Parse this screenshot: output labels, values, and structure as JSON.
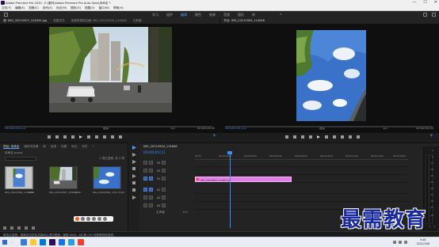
{
  "window": {
    "title": "Adobe Premiere Pro 2020 - E:\\素材\\Adobe Premiere Pro Auto-Save\\未命名 *",
    "controls": [
      "—",
      "☐",
      "✕"
    ]
  },
  "menu": [
    "文件(F)",
    "编辑(E)",
    "剪辑(C)",
    "序列(S)",
    "标记(M)",
    "图形(G)",
    "视图(V)",
    "窗口(W)",
    "帮助(H)"
  ],
  "workspace": {
    "tabs": [
      "学习",
      "组件",
      "编辑",
      "颜色",
      "效果",
      "音频",
      "图形",
      "库"
    ],
    "active": "编辑",
    "more": "»"
  },
  "source_monitor": {
    "tabs": [
      "源: IMG_20210907_154045.jpg",
      "效果控件",
      "音频剪辑混合器: IMG_20210904_114846",
      "元数据"
    ],
    "timecode": "00;00;01;11",
    "fit": "适合",
    "ratio": "1/2",
    "duration": "00;00;05;00"
  },
  "program_monitor": {
    "tabs": [
      "节目: IMG_20210904_114846"
    ],
    "timecode": "00;00;01;11",
    "fit": "适合",
    "ratio": "1/2",
    "duration": "00;00;05;00"
  },
  "project": {
    "tabs": [
      "项目: 未命名",
      "媒体浏览器",
      "库",
      "信息",
      "效果",
      "标记",
      "历史"
    ],
    "more": "»",
    "file": "未命名.prproj",
    "count": "1 项已选择, 共 3 项",
    "items": [
      {
        "name": "IMG_20210904_114846...",
        "duration": "5;00"
      },
      {
        "name": "IMG_20210907_154045...",
        "duration": "5;00"
      },
      {
        "name": "IMG_20210904_1157...",
        "duration": "5;00"
      }
    ]
  },
  "timeline": {
    "tab": "IMG_20210904_114846",
    "timecode": "00;00;01;11",
    "ruler": [
      "00;00",
      "00;00;02;00",
      "00;00;04;00",
      "00;00;06;00",
      "00;00;08;00",
      "00;00;10;00",
      "00;00;12;00",
      "00;00;14;00",
      "00;00;16;00"
    ],
    "video_tracks": [
      "V3",
      "V2",
      "V1"
    ],
    "audio_tracks": [
      "A1",
      "A2",
      "A3"
    ],
    "master_label": "主声道",
    "master_value": "0.0",
    "clip_name": "IMG_20210904_114846.jpg",
    "meter_labels": [
      "0",
      "-6",
      "-12",
      "-18",
      "-24",
      "-30",
      "-36",
      "-42",
      "-48",
      "-54",
      "dB"
    ],
    "meter_solo": [
      "S",
      "S"
    ]
  },
  "hint": "单击以选择，或单击空白处并拖动以进行框选。使用 Shift、Alt 和 Ctrl 可获得其他选项。",
  "taskbar": {
    "search": "○",
    "time": "9:48",
    "date": "2021/10/8",
    "icons": [
      "#3a7bd5",
      "#ffc83d",
      "#0078d4",
      "#2b0b5c",
      "#1a73e8",
      "#2d9cdb",
      "#ea4335"
    ]
  },
  "watermark": "最需教育"
}
